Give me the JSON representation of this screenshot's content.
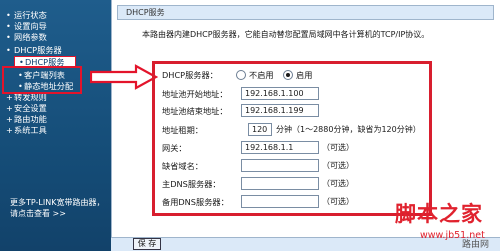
{
  "sidebar": {
    "items": [
      {
        "label": "运行状态"
      },
      {
        "label": "设置向导"
      },
      {
        "label": "网络参数"
      },
      {
        "label": "DHCP服务器"
      },
      {
        "label": "DHCP服务"
      },
      {
        "label": "客户端列表"
      },
      {
        "label": "静态地址分配"
      },
      {
        "label": "转发规则"
      },
      {
        "label": "安全设置"
      },
      {
        "label": "路由功能"
      },
      {
        "label": "系统工具"
      }
    ],
    "footer_line1": "更多TP-LINK宽带路由器，",
    "footer_line2": "请点击查看 >>"
  },
  "main": {
    "title": "DHCP服务",
    "intro": "本路由器内建DHCP服务器，它能自动替您配置局域网中各计算机的TCP/IP协议。"
  },
  "form": {
    "dhcp_server_label": "DHCP服务器：",
    "disable_label": "不启用",
    "enable_label": "启用",
    "enabled": true,
    "start_label": "地址池开始地址：",
    "start_value": "192.168.1.100",
    "end_label": "地址池结束地址：",
    "end_value": "192.168.1.199",
    "lease_label": "地址租期：",
    "lease_value": "120",
    "lease_hint": "分钟（1～2880分钟，缺省为120分钟）",
    "gateway_label": "网关：",
    "gateway_value": "192.168.1.1",
    "gateway_hint": "（可选）",
    "domain_label": "缺省域名：",
    "domain_value": "",
    "domain_hint": "（可选）",
    "dns1_label": "主DNS服务器：",
    "dns1_value": "",
    "dns1_hint": "（可选）",
    "dns2_label": "备用DNS服务器：",
    "dns2_value": "",
    "dns2_hint": "（可选）",
    "save_label": "保 存"
  },
  "watermark": {
    "line1": "脚本之家",
    "line2": "www.jb51.net",
    "line3": "路由网"
  },
  "colors": {
    "sidebar": "#1f5d8c",
    "highlight_red": "#d81e2e",
    "title_bar": "#dbe9f8"
  }
}
